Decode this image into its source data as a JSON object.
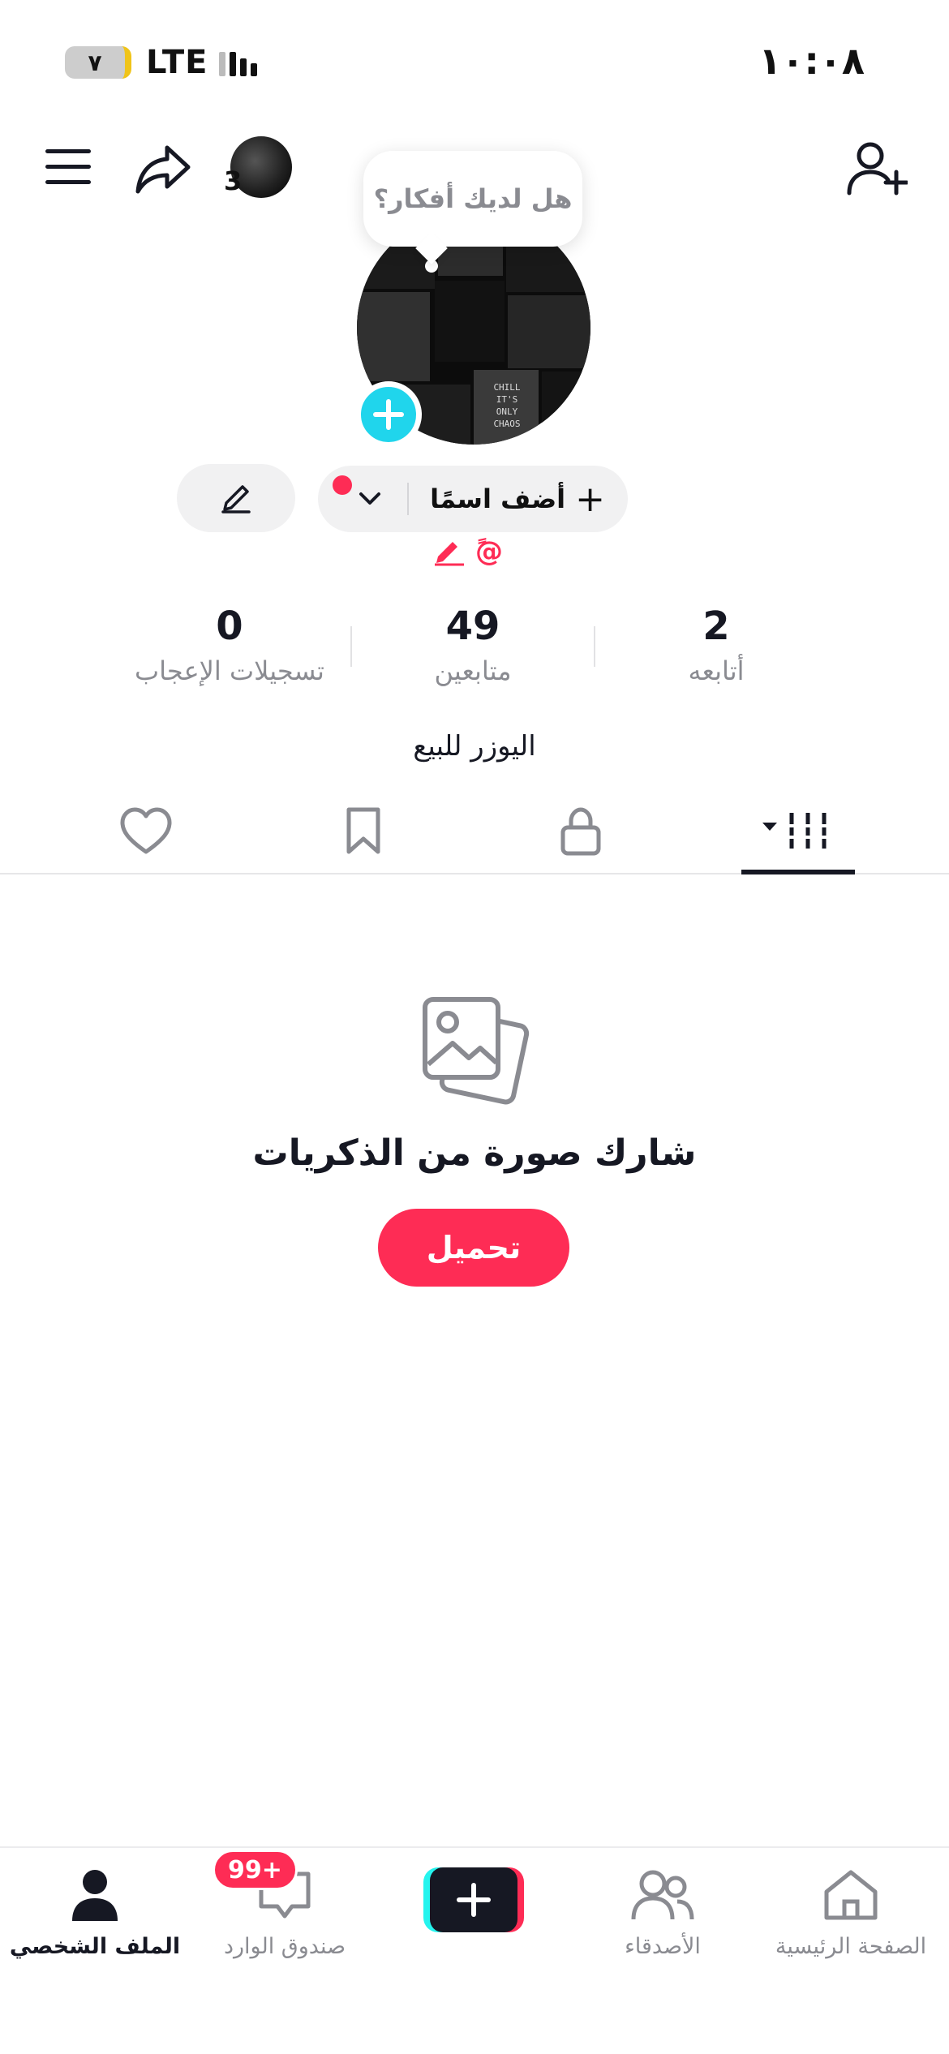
{
  "status_bar": {
    "time": "١٠:٠٨",
    "battery": "٧",
    "network": "LTE"
  },
  "header": {
    "avatar_badge_count": "3",
    "tooltip": "هل لديك أفكار؟"
  },
  "profile": {
    "add_name_label": "أضف اسمًا",
    "add_name_plus": "+",
    "handle": "@ً",
    "bio": "اليوزر للبيع"
  },
  "stats": {
    "following": {
      "value": "2",
      "label": "أتابعه"
    },
    "followers": {
      "value": "49",
      "label": "متابعين"
    },
    "likes": {
      "value": "0",
      "label": "تسجيلات الإعجاب"
    }
  },
  "tabs": [
    {
      "name": "videos",
      "icon": "grid-icon",
      "active": true
    },
    {
      "name": "private",
      "icon": "lock-icon",
      "active": false
    },
    {
      "name": "saved",
      "icon": "bookmark-icon",
      "active": false
    },
    {
      "name": "liked",
      "icon": "heart-icon",
      "active": false
    }
  ],
  "empty_state": {
    "icon": "photos-icon",
    "title": "شارك صورة من الذكريات",
    "button": "تحميل"
  },
  "bottom_nav": {
    "home": "الصفحة الرئيسية",
    "friends": "الأصدقاء",
    "inbox": "صندوق الوارد",
    "inbox_badge": "99+",
    "profile": "الملف الشخصي",
    "active": "profile"
  },
  "colors": {
    "accent": "#fe2c55",
    "cyan": "#25f4ee",
    "avatar_add": "#20d5ec",
    "text_primary": "#161823",
    "text_secondary": "#8a8b91"
  }
}
